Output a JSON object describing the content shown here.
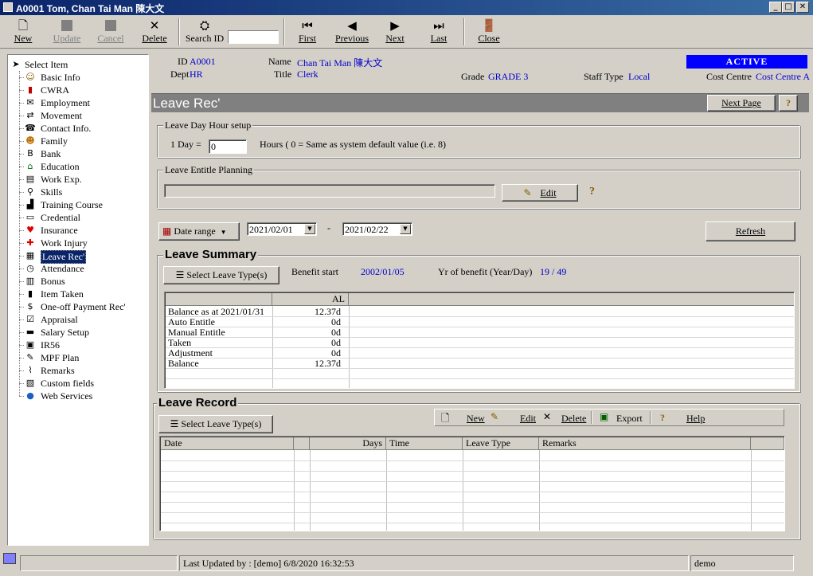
{
  "window": {
    "title": "A0001 Tom, Chan Tai Man 陳大文"
  },
  "toolbar": {
    "new": "New",
    "update": "Update",
    "cancel": "Cancel",
    "delete": "Delete",
    "search_id": "Search ID",
    "search_value": "",
    "first": "First",
    "previous": "Previous",
    "next": "Next",
    "last": "Last",
    "close": "Close"
  },
  "tree": {
    "root": "Select Item",
    "items": [
      {
        "label": "Basic Info",
        "icon": "person-icon"
      },
      {
        "label": "CWRA",
        "icon": "book-icon"
      },
      {
        "label": "Employment",
        "icon": "envelope-icon"
      },
      {
        "label": "Movement",
        "icon": "movement-icon"
      },
      {
        "label": "Contact Info.",
        "icon": "contact-icon"
      },
      {
        "label": "Family",
        "icon": "family-icon"
      },
      {
        "label": "Bank",
        "icon": "bank-icon"
      },
      {
        "label": "Education",
        "icon": "education-icon"
      },
      {
        "label": "Work Exp.",
        "icon": "document-icon"
      },
      {
        "label": "Skills",
        "icon": "skills-icon"
      },
      {
        "label": "Training Course",
        "icon": "training-icon"
      },
      {
        "label": "Credential",
        "icon": "credential-icon"
      },
      {
        "label": "Insurance",
        "icon": "heart-icon"
      },
      {
        "label": "Work Injury",
        "icon": "cross-icon"
      },
      {
        "label": "Leave Rec'",
        "icon": "calendar-icon"
      },
      {
        "label": "Attendance",
        "icon": "clock-icon"
      },
      {
        "label": "Bonus",
        "icon": "bonus-icon"
      },
      {
        "label": "Item Taken",
        "icon": "item-icon"
      },
      {
        "label": "One-off Payment Rec'",
        "icon": "dollar-icon"
      },
      {
        "label": "Appraisal",
        "icon": "checklist-icon"
      },
      {
        "label": "Salary Setup",
        "icon": "salary-icon"
      },
      {
        "label": "IR56",
        "icon": "ir56-icon"
      },
      {
        "label": "MPF Plan",
        "icon": "mpf-icon"
      },
      {
        "label": "Remarks",
        "icon": "paperclip-icon"
      },
      {
        "label": "Custom fields",
        "icon": "custom-icon"
      },
      {
        "label": "Web Services",
        "icon": "globe-icon"
      }
    ],
    "selected_index": 14
  },
  "header": {
    "id_label": "ID",
    "id_value": "A0001",
    "dept_label": "Dept",
    "dept_value": "HR",
    "name_label": "Name",
    "name_value": "Chan Tai Man 陳大文",
    "title_label": "Title",
    "title_value": "Clerk",
    "grade_label": "Grade",
    "grade_value": "GRADE 3",
    "staff_type_label": "Staff Type",
    "staff_type_value": "Local",
    "cost_centre_label": "Cost Centre",
    "cost_centre_value": "Cost Centre A",
    "status": "ACTIVE"
  },
  "module": {
    "title": "Leave Rec'",
    "next_page": "Next Page",
    "help": "?"
  },
  "leave_day_hour": {
    "group_title": "Leave Day Hour setup",
    "one_day_label": "1 Day =",
    "one_day_value": "0",
    "hint": "Hours ( 0 = Same as system default value  (i.e. 8)"
  },
  "entitle_planning": {
    "group_title": "Leave Entitle Planning",
    "value": "",
    "edit": "Edit"
  },
  "date_range": {
    "label": "Date range",
    "from": "2021/02/01",
    "separator": "-",
    "to": "2021/02/22",
    "refresh": "Refresh"
  },
  "summary": {
    "title": "Leave Summary",
    "select_types": "Select Leave Type(s)",
    "benefit_start_label": "Benefit start",
    "benefit_start_value": "2002/01/05",
    "yr_benefit_label": "Yr of benefit (Year/Day)",
    "yr_benefit_value": "19 / 49",
    "columns": [
      "",
      "AL"
    ],
    "rows": [
      [
        "Balance as at 2021/01/31",
        "12.37d"
      ],
      [
        "Auto Entitle",
        "0d"
      ],
      [
        "Manual Entitle",
        "0d"
      ],
      [
        "Taken",
        "0d"
      ],
      [
        "Adjustment",
        "0d"
      ],
      [
        "Balance",
        "12.37d"
      ]
    ]
  },
  "record": {
    "title": "Leave Record",
    "select_types": "Select Leave Type(s)",
    "new": "New",
    "edit": "Edit",
    "delete": "Delete",
    "export": "Export",
    "help": "Help",
    "columns": [
      "Date",
      "",
      "Days",
      "Time",
      "Leave Type",
      "Remarks"
    ]
  },
  "status": {
    "last_updated": "Last Updated by : [demo]  6/8/2020 16:32:53",
    "user": "demo"
  },
  "colors": {
    "title_bar": "#0a246a",
    "active_badge": "#0000ff",
    "value_text": "#0000cc",
    "module_bar": "#808080"
  }
}
